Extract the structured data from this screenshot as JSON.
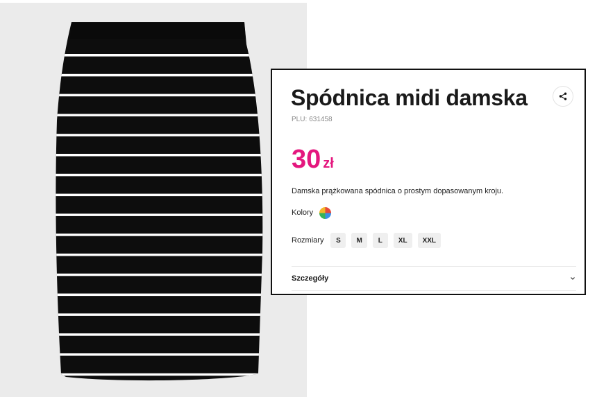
{
  "product": {
    "title": "Spódnica midi damska",
    "plu_label": "PLU:",
    "plu_value": "631458",
    "price_amount": "30",
    "price_currency": "zł",
    "description": "Damska prążkowana spódnica o prostym dopasowanym kroju.",
    "colors_label": "Kolory",
    "sizes_label": "Rozmiary",
    "sizes": [
      "S",
      "M",
      "L",
      "XL",
      "XXL"
    ],
    "details_label": "Szczegóły"
  },
  "icons": {
    "share": "share-icon",
    "chevron": "chevron-down-icon",
    "color": "multicolor-swatch-icon"
  },
  "colors": {
    "price": "#e4177e",
    "image_background": "#ebebeb",
    "skirt": "#0d0d0d",
    "stripe": "#ffffff"
  }
}
